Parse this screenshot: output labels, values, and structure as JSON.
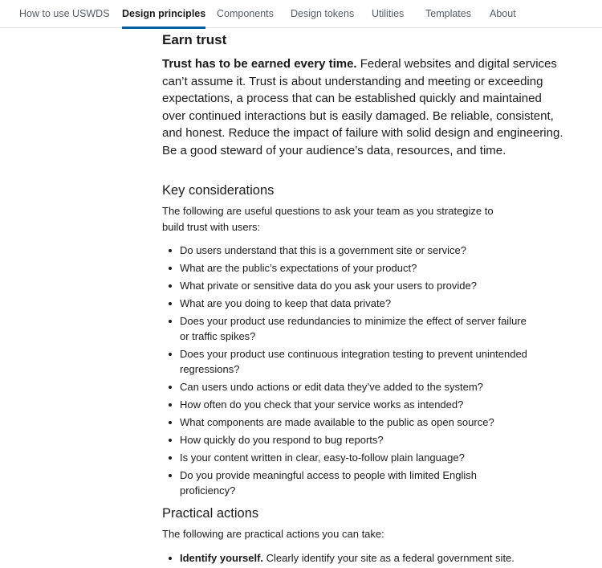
{
  "nav": {
    "items": [
      {
        "label": "How to use USWDS",
        "active": false
      },
      {
        "label": "Design principles",
        "active": true
      },
      {
        "label": "Components",
        "active": false
      },
      {
        "label": "Design tokens",
        "active": false
      },
      {
        "label": "Utilities",
        "active": false
      },
      {
        "label": "Templates",
        "active": false
      },
      {
        "label": "About",
        "active": false
      }
    ],
    "accent_color": "#005ea2"
  },
  "section": {
    "title": "Earn trust",
    "lead_bold": "Trust has to be earned every time.",
    "lead_text": " Federal websites and digital services can’t assume it. Trust is about understanding and meeting or exceeding expectations, a process that can be established quickly and maintained over continued interactions but is easily damaged. Be reliable, consistent, and honest. Reduce the impact of failure with solid design and engineering. Be a good steward of your audience’s data, resources, and time."
  },
  "key_considerations": {
    "heading": "Key considerations",
    "intro": "The following are useful questions to ask your team as you strategize to build trust with users:",
    "items": [
      "Do users understand that this is a government site or service?",
      "What are the public’s expectations of your product?",
      "What private or sensitive data do you ask your users to provide?",
      "What are you doing to keep that data private?",
      "Does your product use redundancies to minimize the effect of server failure or traffic spikes?",
      "Does your product use continuous integration testing to prevent unintended regressions?",
      "Can users undo actions or edit data they’ve added to the system?",
      "How often do you check that your service works as intended?",
      "What components are made available to the public as open source?",
      "How quickly do you respond to bug reports?",
      "Is your content written in clear, easy-to-follow plain language?",
      "Do you provide meaningful access to people with limited English proficiency?"
    ]
  },
  "practical_actions": {
    "heading": "Practical actions",
    "intro": "The following are practical actions you can take:",
    "items": [
      {
        "bold": "Identify yourself.",
        "text": " Clearly identify your site as a federal government site."
      }
    ]
  }
}
